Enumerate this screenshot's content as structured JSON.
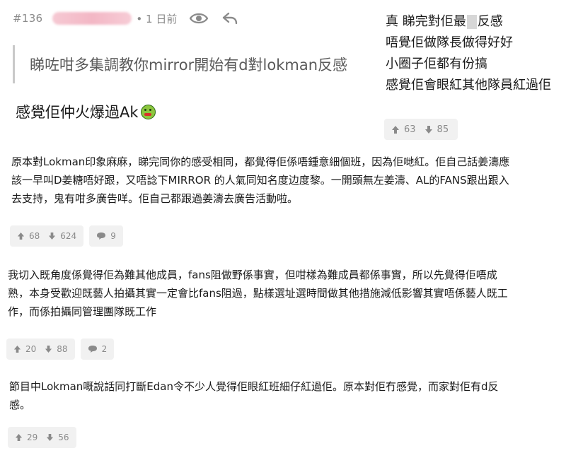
{
  "post": {
    "number": "#136",
    "time": "• 1 日前",
    "quote": "睇咗咁多集調教你mirror開始有d對lokman反感",
    "text": "感覺佢仲火爆過Ak"
  },
  "side_card": {
    "line1_a": "真 睇完對佢最",
    "line1_b": "反感",
    "line2": "唔覺佢做隊長做得好好",
    "line3": "小圈子佢都有份搞",
    "line4": "感覺佢會眼紅其他隊員紅過佢",
    "up": "63",
    "down": "85"
  },
  "comments": [
    {
      "lines": [
        "原本對Lokman印象麻麻，睇完同你的感受相同，都覺得佢係唔鍾意細個班，因為佢哋紅。佢自己話姜濤應",
        "該一早叫D姜糖唔好跟，又唔諗下MIRROR 的人氣同知名度边度黎。一開頭無左姜濤、AL的FANS跟出跟入",
        "去支持，鬼有咁多廣告咩。佢自己都跟過姜濤去廣告活動啦。"
      ],
      "up": "68",
      "down": "624",
      "replies": "9"
    },
    {
      "lines": [
        "我切入既角度係覺得佢為難其他成員，fans阻做野係事實，但咁樣為難成員都係事實，所以先覺得佢唔成",
        "熟，本身受歡迎既藝人拍攝其實一定會比fans阻過，點樣選址選時間做其他措施減低影響其實唔係藝人既工",
        "作，而係拍攝同管理團隊既工作"
      ],
      "up": "20",
      "down": "88",
      "replies": "2"
    },
    {
      "lines": [
        "節目中Lokman嘅說話同打斷Edan令不少人覺得佢眼紅班細仔紅過佢。原本對佢冇感覺，而家對佢有d反",
        "感。"
      ],
      "up": "29",
      "down": "56"
    }
  ]
}
